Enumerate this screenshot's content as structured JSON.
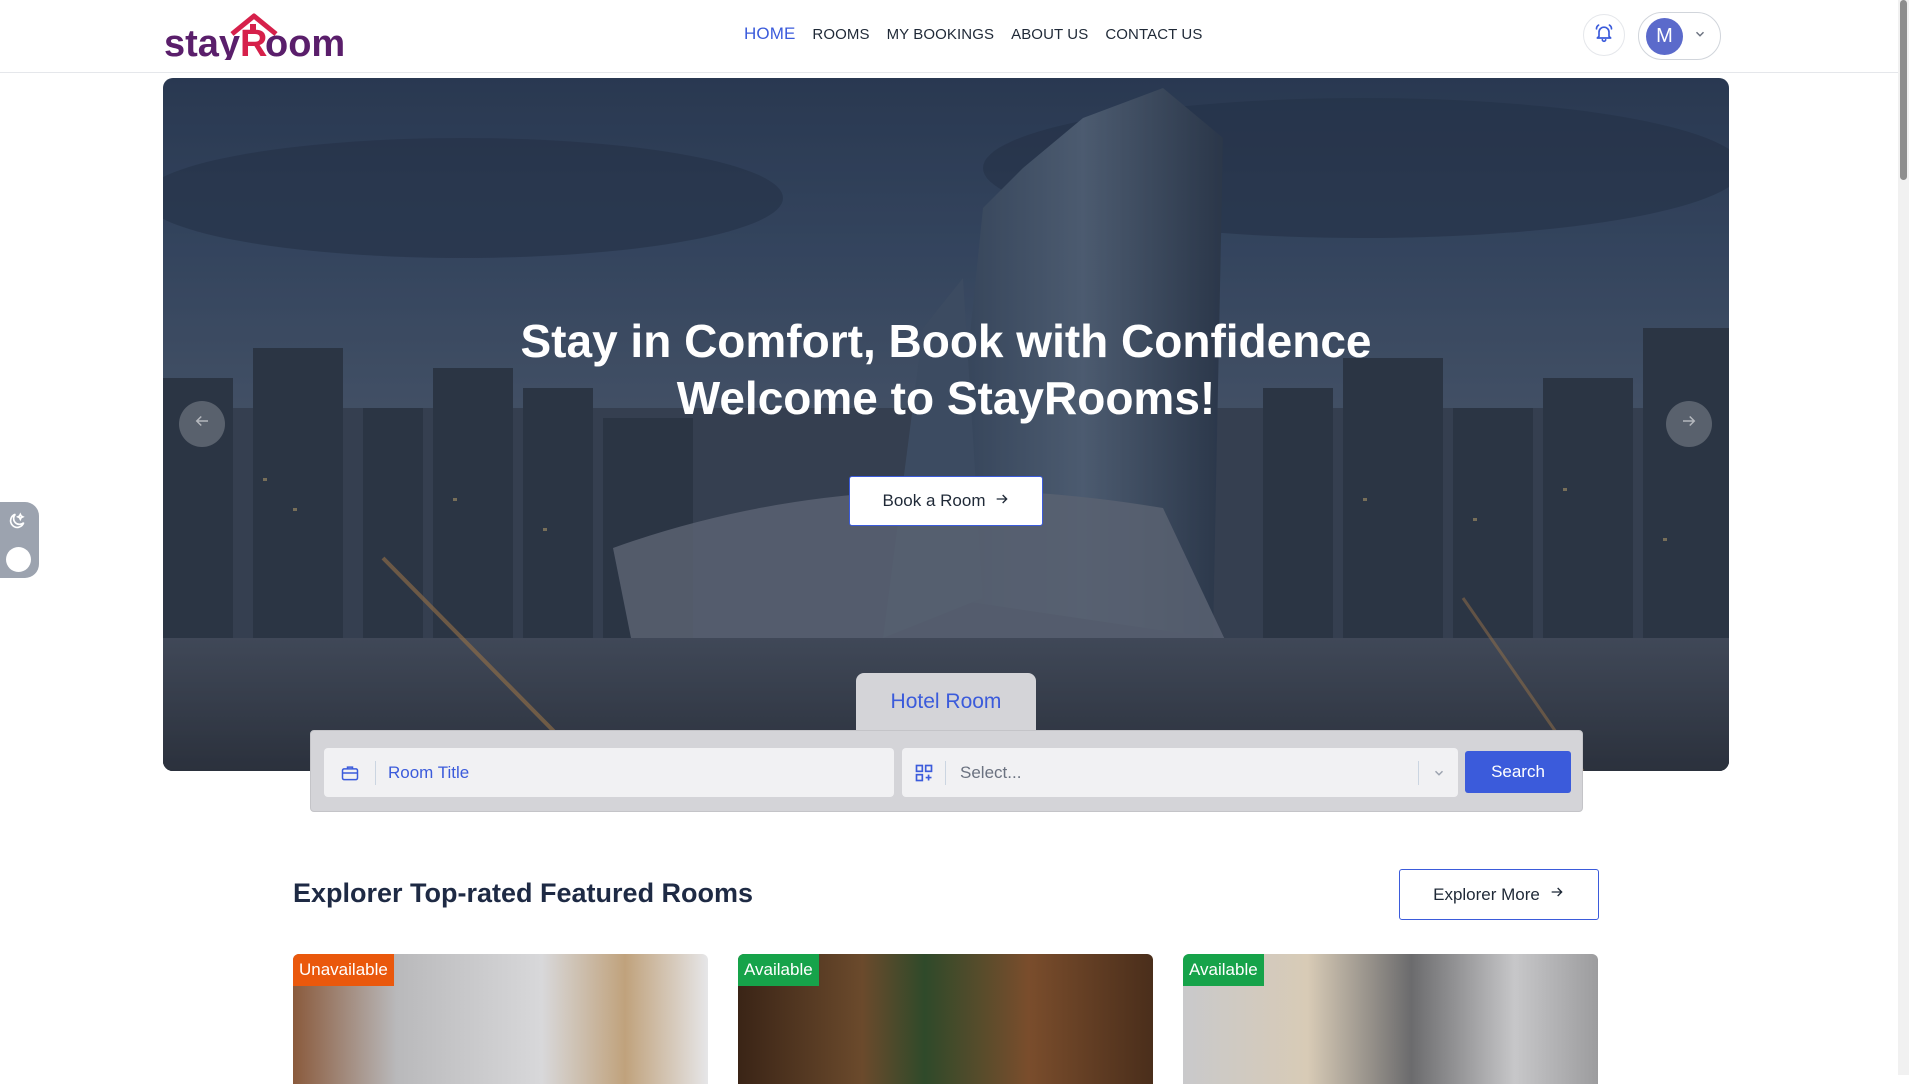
{
  "header": {
    "logo_text": "stayRooms",
    "nav": [
      {
        "label": "HOME",
        "active": true
      },
      {
        "label": "ROOMS",
        "active": false
      },
      {
        "label": "MY BOOKINGS",
        "active": false
      },
      {
        "label": "ABOUT US",
        "active": false
      },
      {
        "label": "CONTACT US",
        "active": false
      }
    ],
    "user_initial": "M",
    "bell_icon": "bell-icon",
    "chevron_icon": "chevron-down-icon"
  },
  "hero": {
    "title_line1": "Stay in Comfort, Book with Confidence",
    "title_line2": "Welcome to StayRooms!",
    "book_button": "Book a Room",
    "prev_icon": "arrow-left-icon",
    "next_icon": "arrow-right-icon"
  },
  "search": {
    "tab_label": "Hotel Room",
    "title_value": "Room Title",
    "category_placeholder": "Select...",
    "button": "Search"
  },
  "featured": {
    "title": "Explorer Top-rated Featured Rooms",
    "explore_button": "Explorer More",
    "cards": [
      {
        "status": "Unavailable",
        "status_color": "#ea580c"
      },
      {
        "status": "Available",
        "status_color": "#16a34a"
      },
      {
        "status": "Available",
        "status_color": "#16a34a"
      }
    ]
  },
  "colors": {
    "accent": "#3b5bdb",
    "logo_primary": "#5a1e6b",
    "logo_secondary": "#d6204a"
  }
}
